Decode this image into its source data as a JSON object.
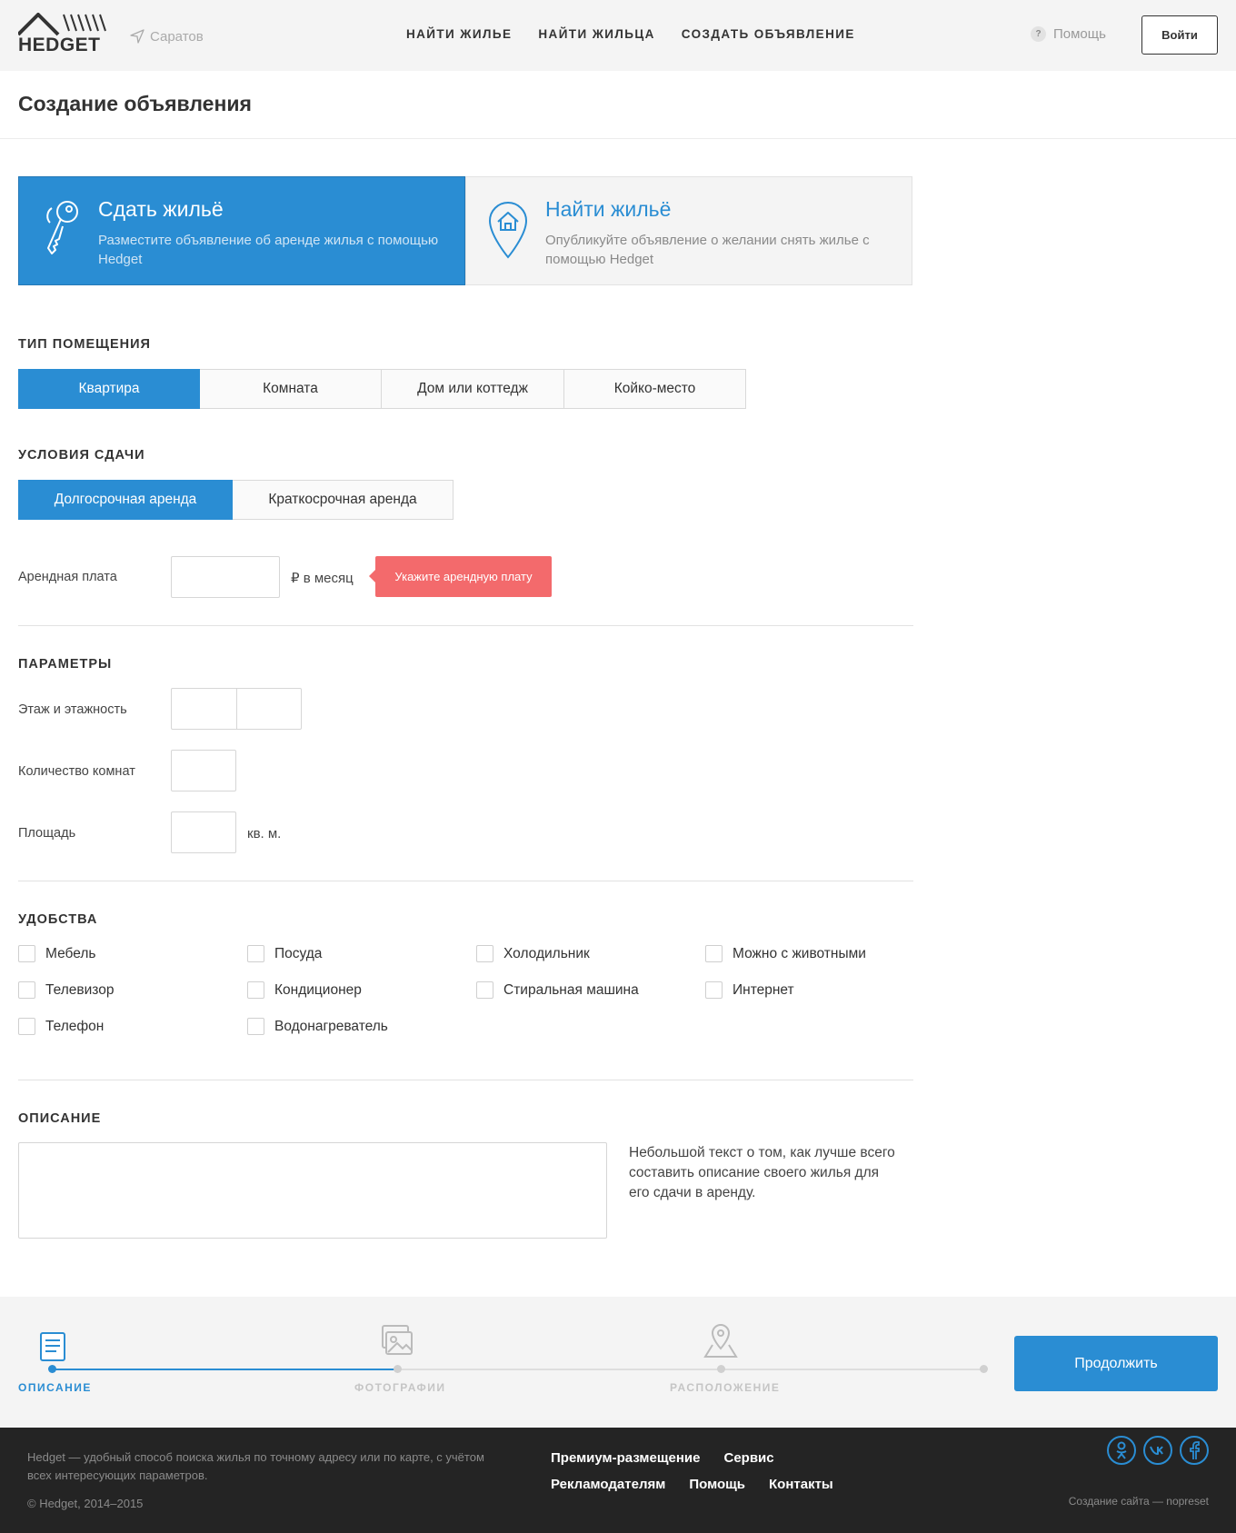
{
  "header": {
    "logo_text": "HEDGET",
    "city": "Саратов",
    "nav": [
      "НАЙТИ ЖИЛЬЕ",
      "НАЙТИ ЖИЛЬЦА",
      "СОЗДАТЬ ОБЪЯВЛЕНИЕ"
    ],
    "help_icon": "?",
    "help": "Помощь",
    "login": "Войти"
  },
  "page_title": "Создание объявления",
  "modes": [
    {
      "title": "Сдать жильё",
      "text": "Разместите объявление об аренде жилья с помощью Hedget",
      "active": true,
      "icon": "keys-icon"
    },
    {
      "title": "Найти жильё",
      "text": "Опубликуйте объявление о желании снять жилье с помощью Hedget",
      "active": false,
      "icon": "house-pin-icon"
    }
  ],
  "property_type": {
    "label": "ТИП ПОМЕЩЕНИЯ",
    "options": [
      "Квартира",
      "Комната",
      "Дом или коттедж",
      "Койко-место"
    ],
    "selected": "Квартира"
  },
  "rent_terms": {
    "label": "УСЛОВИЯ СДАЧИ",
    "options": [
      "Долгосрочная аренда",
      "Краткосрочная аренда"
    ],
    "selected": "Долгосрочная аренда"
  },
  "rent": {
    "label": "Арендная плата",
    "unit": "₽ в месяц",
    "value": "",
    "error": "Укажите арендную плату"
  },
  "params": {
    "label": "ПАРАМЕТРЫ",
    "floor_label": "Этаж и этажность",
    "rooms_label": "Количество комнат",
    "area_label": "Площадь",
    "area_unit": "кв. м."
  },
  "amenities": {
    "label": "УДОБСТВА",
    "items": [
      "Мебель",
      "Посуда",
      "Холодильник",
      "Можно с животными",
      "Телевизор",
      "Кондиционер",
      "Стиральная машина",
      "Интернет",
      "Телефон",
      "Водонагреватель"
    ]
  },
  "description": {
    "label": "ОПИСАНИЕ",
    "value": "",
    "hint": "Небольшой текст о том, как лучше всего составить описание своего жилья для его сдачи в аренду."
  },
  "steps": {
    "items": [
      "ОПИСАНИЕ",
      "ФОТОГРАФИИ",
      "РАСПОЛОЖЕНИЕ"
    ],
    "current": 0,
    "continue": "Продолжить"
  },
  "footer": {
    "text": "Hedget — удобный способ поиска жилья по точному адресу или по карте, с учётом всех интересующих параметров.",
    "copyright": "© Hedget, 2014–2015",
    "links": [
      "Премиум-размещение",
      "Сервис",
      "Рекламодателям",
      "Помощь",
      "Контакты"
    ],
    "social": [
      "ok-icon",
      "vk-icon",
      "facebook-icon"
    ],
    "credit": "Создание сайта — nopreset"
  },
  "colors": {
    "accent": "#2a8dd3",
    "error": "#f36a6c",
    "footer_bg": "#242424"
  }
}
